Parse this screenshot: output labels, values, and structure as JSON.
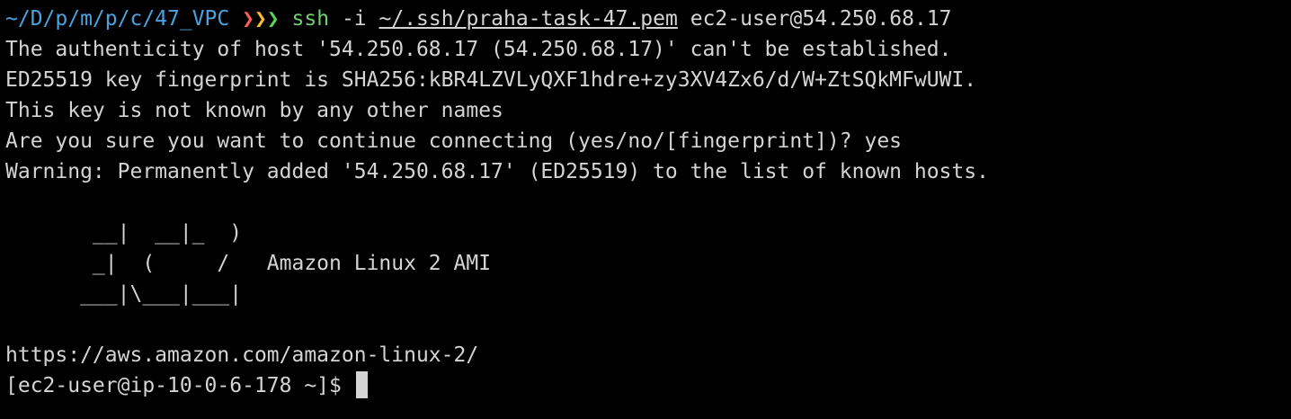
{
  "prompt": {
    "cwd": "~/D/p/m/p/c/47_VPC",
    "chevrons": [
      "❯",
      "❯",
      "❯"
    ],
    "colors": {
      "cwd": "#4aa3df",
      "chevron_1": "#ff5f56",
      "chevron_2": "#ffbd2e",
      "chevron_3": "#5ad35a",
      "command": "#6fd26f",
      "text": "#d4d4d4",
      "background": "#000000"
    }
  },
  "command": {
    "program": "ssh",
    "flag": "-i",
    "keyfile": "~/.ssh/praha-task-47.pem",
    "target": "ec2-user@54.250.68.17"
  },
  "output": {
    "authenticity": "The authenticity of host '54.250.68.17 (54.250.68.17)' can't be established.",
    "fingerprint": "ED25519 key fingerprint is SHA256:kBR4LZVLyQXF1hdre+zy3XV4Zx6/d/W+ZtSQkMFwUWI.",
    "not_known": "This key is not known by any other names",
    "confirm_question": "Are you sure you want to continue connecting (yes/no/[fingerprint])? ",
    "confirm_answer": "yes",
    "warning": "Warning: Permanently added '54.250.68.17' (ED25519) to the list of known hosts."
  },
  "banner": {
    "art_1": "       __|  __|_  )",
    "art_2": "       _|  (     /",
    "art_2_label": "   Amazon Linux 2 AMI",
    "art_3": "      ___|\\___|___|",
    "url": "https://aws.amazon.com/amazon-linux-2/"
  },
  "remote_prompt": "[ec2-user@ip-10-0-6-178 ~]$ "
}
